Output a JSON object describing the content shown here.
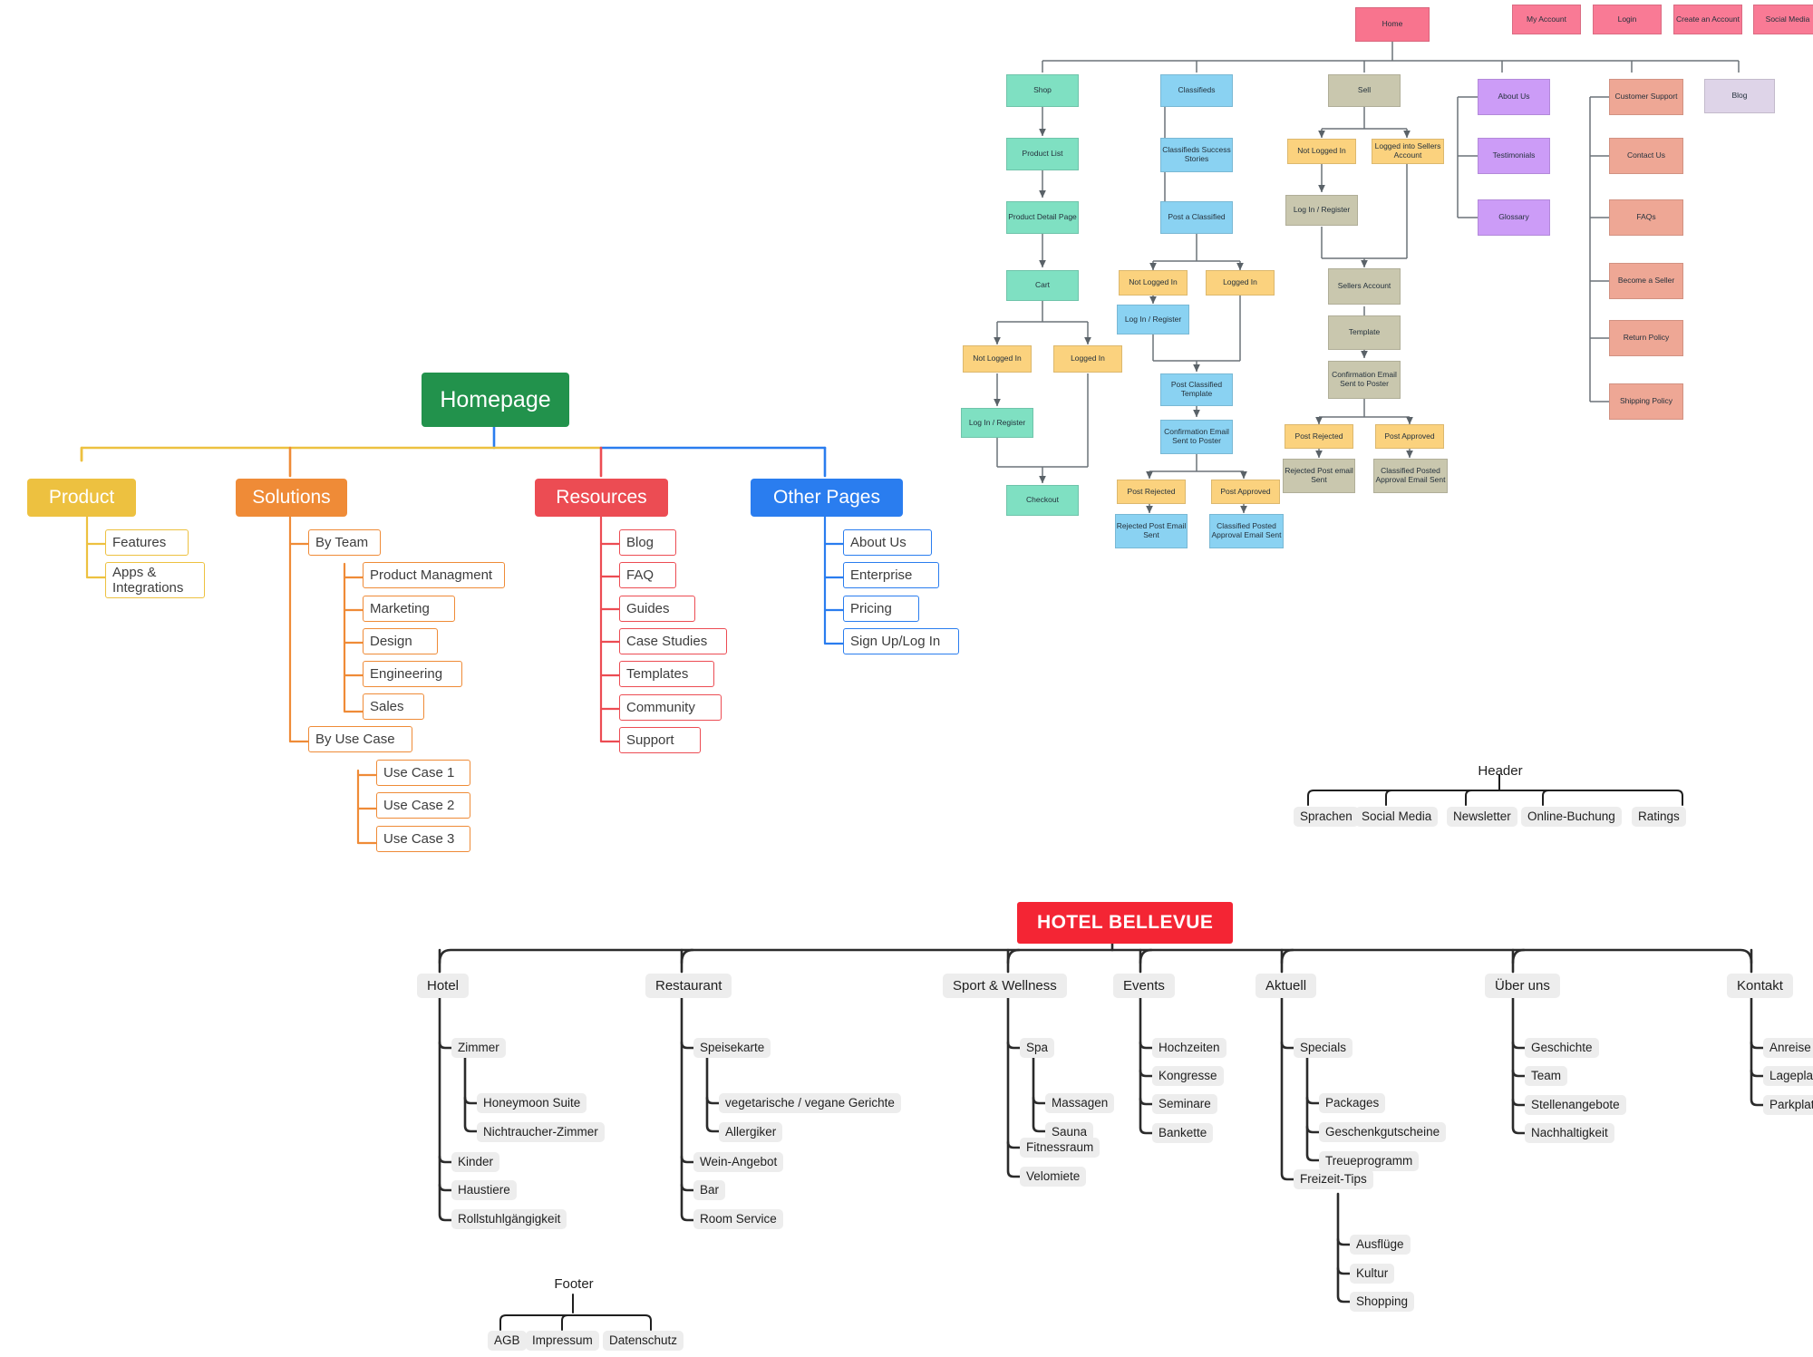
{
  "colors": {
    "home_pink": "#f8748e",
    "shop_green": "#7fe0c2",
    "classifieds_blue": "#8ad2f2",
    "state_yellow": "#fbd27e",
    "sell_khaki": "#c9c7ae",
    "about_purple": "#cc9cf7",
    "support_salmon": "#eea795",
    "blog_lilac": "#ded4e8",
    "homepage_green": "#22924c",
    "product_yellow": "#edc140",
    "solutions_orange": "#ef8b37",
    "resources_red": "#ec4c53",
    "other_blue": "#2a7def",
    "hotel_red": "#f42534",
    "mindmap_chip": "#ededed"
  },
  "ecommerce_flow": {
    "root": "Home",
    "account_buttons": [
      "My Account",
      "Login",
      "Create an Account",
      "Social Media"
    ],
    "shop": {
      "title": "Shop",
      "chain": [
        "Product List",
        "Product Detail Page",
        "Cart"
      ],
      "states": [
        "Not Logged In",
        "Logged In"
      ],
      "login": "Log In / Register",
      "end": "Checkout"
    },
    "classifieds": {
      "title": "Classifieds",
      "siblings": [
        "Classifieds Success Stories",
        "Post a Classified"
      ],
      "states": [
        "Not Logged In",
        "Logged In"
      ],
      "login": "Log In / Register",
      "template": "Post Classified Template",
      "confirmation": "Confirmation Email Sent to Poster",
      "outcomes": [
        "Post Rejected",
        "Post Approved"
      ],
      "emails": [
        "Rejected Post Email Sent",
        "Classified Posted Approval Email Sent"
      ]
    },
    "sell": {
      "title": "Sell",
      "states": [
        "Not Logged In",
        "Logged into Sellers Account"
      ],
      "login": "Log In / Register",
      "account": "Sellers Account",
      "template": "Template",
      "confirmation": "Confirmation Email Sent to Poster",
      "outcomes": [
        "Post Rejected",
        "Post Approved"
      ],
      "emails": [
        "Rejected Post email Sent",
        "Classified Posted Approval Email Sent"
      ]
    },
    "about": {
      "title": "About Us",
      "children": [
        "Testimonials",
        "Glossary"
      ]
    },
    "support": {
      "title": "Customer Support",
      "children": [
        "Contact Us",
        "FAQs",
        "Become a Seller",
        "Return Policy",
        "Shipping Policy"
      ]
    },
    "blog": {
      "title": "Blog"
    }
  },
  "sitemap": {
    "root": "Homepage",
    "categories": [
      {
        "label": "Product",
        "children": [
          {
            "label": "Features"
          },
          {
            "label": "Apps & Integrations"
          }
        ]
      },
      {
        "label": "Solutions",
        "children": [
          {
            "label": "By Team",
            "children": [
              "Product Managment",
              "Marketing",
              "Design",
              "Engineering",
              "Sales"
            ]
          },
          {
            "label": "By Use Case",
            "children": [
              "Use Case 1",
              "Use Case 2",
              "Use Case 3"
            ]
          }
        ]
      },
      {
        "label": "Resources",
        "children": [
          {
            "label": "Blog"
          },
          {
            "label": "FAQ"
          },
          {
            "label": "Guides"
          },
          {
            "label": "Case Studies"
          },
          {
            "label": "Templates"
          },
          {
            "label": "Community"
          },
          {
            "label": "Support"
          }
        ]
      },
      {
        "label": "Other Pages",
        "children": [
          {
            "label": "About Us"
          },
          {
            "label": "Enterprise"
          },
          {
            "label": "Pricing"
          },
          {
            "label": "Sign Up/Log In"
          }
        ]
      }
    ]
  },
  "header_map": {
    "title": "Header",
    "items": [
      "Sprachen",
      "Social Media",
      "Newsletter",
      "Online-Buchung",
      "Ratings"
    ]
  },
  "footer_map": {
    "title": "Footer",
    "items": [
      "AGB",
      "Impressum",
      "Datenschutz"
    ]
  },
  "hotel": {
    "title": "HOTEL BELLEVUE",
    "branches": [
      {
        "label": "Hotel",
        "children": [
          {
            "label": "Zimmer",
            "children": [
              "Honeymoon Suite",
              "Nichtraucher-Zimmer"
            ]
          },
          {
            "label": "Kinder"
          },
          {
            "label": "Haustiere"
          },
          {
            "label": "Rollstuhlgängigkeit"
          }
        ]
      },
      {
        "label": "Restaurant",
        "children": [
          {
            "label": "Speisekarte",
            "children": [
              "vegetarische / vegane Gerichte",
              "Allergiker"
            ]
          },
          {
            "label": "Wein-Angebot"
          },
          {
            "label": "Bar"
          },
          {
            "label": "Room Service"
          }
        ]
      },
      {
        "label": "Sport & Wellness",
        "children": [
          {
            "label": "Spa",
            "children": [
              "Massagen",
              "Sauna"
            ]
          },
          {
            "label": "Fitnessraum"
          },
          {
            "label": "Velomiete"
          }
        ]
      },
      {
        "label": "Events",
        "children": [
          {
            "label": "Hochzeiten"
          },
          {
            "label": "Kongresse"
          },
          {
            "label": "Seminare"
          },
          {
            "label": "Bankette"
          }
        ]
      },
      {
        "label": "Aktuell",
        "children": [
          {
            "label": "Specials",
            "children": [
              "Packages",
              "Geschenkgutscheine",
              "Treueprogramm"
            ]
          },
          {
            "label": "Freizeit-Tips",
            "children": [
              "Ausflüge",
              "Kultur",
              "Shopping"
            ]
          }
        ]
      },
      {
        "label": "Über uns",
        "children": [
          {
            "label": "Geschichte"
          },
          {
            "label": "Team"
          },
          {
            "label": "Stellenangebote"
          },
          {
            "label": "Nachhaltigkeit"
          }
        ]
      },
      {
        "label": "Kontakt",
        "children": [
          {
            "label": "Anreise"
          },
          {
            "label": "Lageplan"
          },
          {
            "label": "Parkplatz"
          }
        ]
      }
    ]
  }
}
